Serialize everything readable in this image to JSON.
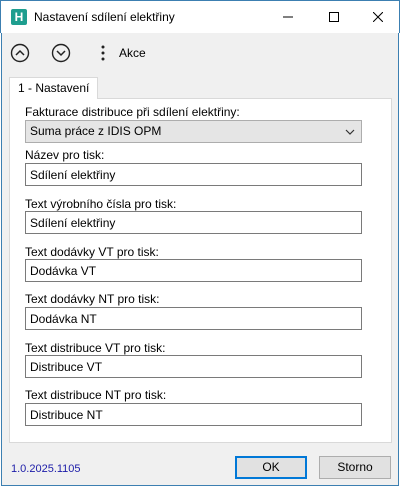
{
  "window": {
    "title": "Nastavení sdílení elektřiny",
    "app_icon_letter": "H"
  },
  "toolbar": {
    "action_label": "Akce"
  },
  "tabs": [
    {
      "label": "1 - Nastavení"
    }
  ],
  "form": {
    "fakturace": {
      "label": "Fakturace distribuce při sdílení elektřiny:",
      "value": "Suma práce z IDIS OPM"
    },
    "nazev": {
      "label": "Název pro tisk:",
      "value": "Sdílení elektřiny"
    },
    "text_vyrobniho_cisla": {
      "label": "Text výrobního čísla pro tisk:",
      "value": "Sdílení elektřiny"
    },
    "text_dodavky_vt": {
      "label": "Text dodávky VT pro tisk:",
      "value": "Dodávka VT"
    },
    "text_dodavky_nt": {
      "label": "Text dodávky NT pro tisk:",
      "value": "Dodávka NT"
    },
    "text_distribuce_vt": {
      "label": "Text distribuce VT pro tisk:",
      "value": "Distribuce VT"
    },
    "text_distribuce_nt": {
      "label": "Text distribuce NT pro tisk:",
      "value": "Distribuce NT"
    }
  },
  "footer": {
    "version": "1.0.2025.1105",
    "ok_label": "OK",
    "cancel_label": "Storno"
  }
}
